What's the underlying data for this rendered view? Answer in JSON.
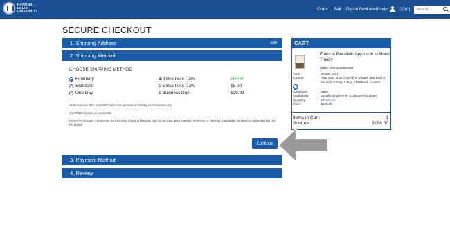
{
  "header": {
    "brand_line1": "NATIONAL",
    "brand_line2": "LOUIS",
    "brand_line3": "UNIVERSITY",
    "nav": [
      "Order",
      "Sell",
      "Digital Bookshelf",
      "Help"
    ],
    "cart_count": "(0)",
    "search_placeholder": "Search"
  },
  "page_title": "SECURE CHECKOUT",
  "steps": {
    "shipping_address": "1. Shipping Address",
    "edit_label": "Edit",
    "shipping_method": "2. Shipping Method",
    "payment_method": "3. Payment Method",
    "review": "4. Review"
  },
  "shipping": {
    "label": "CHOOSE SHIPPING METHOD",
    "options": [
      {
        "name": "Economy",
        "days": "4-8 Business Days",
        "price": "FREE!",
        "selected": true
      },
      {
        "name": "Standard",
        "days": "1-5 Business Days",
        "price": "$5.00",
        "selected": false
      },
      {
        "name": "One Day",
        "days": "1 Business Day",
        "price": "$29.99",
        "selected": false
      }
    ],
    "notes": [
      "Orders placed after 11AM EST will not be processed until the next business day.",
      "No UPS Deliveries on weekends",
      "HI/AK/PR/VI/Guam - shipments via Economy Shipping (Regular USPS) can take up to 4 weeks. UPS One or Two Day is available for physical addresses but not PO Boxes."
    ],
    "continue_label": "Continue"
  },
  "cart": {
    "title": "CART",
    "book_title": "Ethics A Pluralistic Approach to Moral Theory",
    "isbn": "ISBN: 9781133050018",
    "details": [
      {
        "k": "Term:",
        "v": "Winter 2021"
      },
      {
        "k": "Course:",
        "v": "ABS 305: 10270 0 Phil of Values and Ethics Complimentary 7-Day eTextbook Access"
      },
      {
        "k": "Condition:",
        "v": "NEW"
      },
      {
        "k": "Availability:",
        "v": "Usually Ships in 8 - 10 Business Days."
      },
      {
        "k": "Quantity:",
        "v": "1 Remove"
      },
      {
        "k": "Price:",
        "v": "$198.00"
      }
    ],
    "items_label": "Items in Cart:",
    "items_value": "1",
    "subtotal_label": "Subtotal:",
    "subtotal_value": "$198.00"
  },
  "colors": {
    "primary": "#1a5ca8",
    "nav": "#1a4f93",
    "free": "#2e9a3a"
  }
}
